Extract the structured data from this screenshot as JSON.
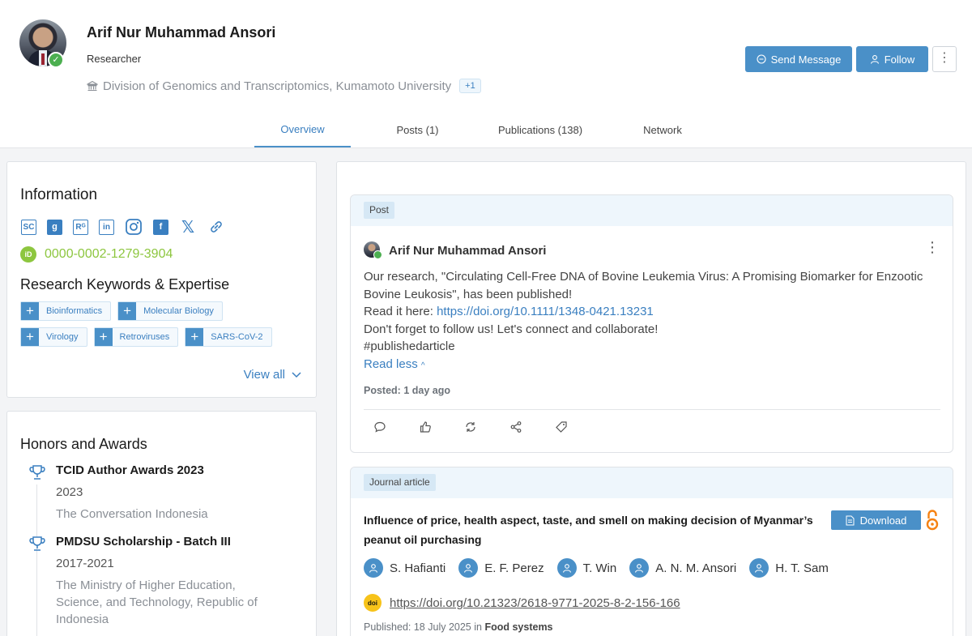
{
  "profile": {
    "name": "Arif Nur Muhammad Ansori",
    "role": "Researcher",
    "affiliation": "Division of Genomics and Transcriptomics, Kumamoto University",
    "affiliation_more": "+1",
    "verified_icon": "check-icon"
  },
  "actions": {
    "send_message": "Send Message",
    "follow": "Follow",
    "more": "⋮"
  },
  "tabs": [
    {
      "label": "Overview",
      "active": true
    },
    {
      "label": "Posts (1)",
      "active": false
    },
    {
      "label": "Publications (138)",
      "active": false
    },
    {
      "label": "Network",
      "active": false
    }
  ],
  "information": {
    "title": "Information",
    "socials": [
      {
        "name": "sciprofiles-icon",
        "glyph": "SC"
      },
      {
        "name": "google-scholar-icon",
        "glyph": "g"
      },
      {
        "name": "researchgate-icon",
        "glyph": "Rᴳ"
      },
      {
        "name": "linkedin-icon",
        "glyph": "in"
      },
      {
        "name": "instagram-icon",
        "glyph": ""
      },
      {
        "name": "facebook-icon",
        "glyph": "f"
      },
      {
        "name": "x-icon",
        "glyph": "𝕏"
      },
      {
        "name": "link-icon",
        "glyph": ""
      }
    ],
    "orcid": "0000-0002-1279-3904",
    "keywords_title": "Research Keywords & Expertise",
    "keywords": [
      "Bioinformatics",
      "Molecular Biology",
      "Virology",
      "Retroviruses",
      "SARS-CoV-2"
    ],
    "view_all": "View all"
  },
  "honors": {
    "title": "Honors and Awards",
    "items": [
      {
        "title": "TCID Author Awards 2023",
        "year": "2023",
        "org": "The Conversation Indonesia"
      },
      {
        "title": "PMDSU Scholarship - Batch III",
        "year": "2017-2021",
        "org": "The Ministry of Higher Education, Science, and Technology, Republic of Indonesia"
      }
    ]
  },
  "post": {
    "tag": "Post",
    "author": "Arif Nur Muhammad Ansori",
    "line1": "Our research, \"Circulating Cell-Free DNA of Bovine Leukemia Virus: A Promising Biomarker for Enzootic Bovine Leukosis\", has been published!",
    "read_prefix": "Read it here: ",
    "link": "https://doi.org/10.1111/1348-0421.13231",
    "line3": "Don't forget to follow us! Let's connect and collaborate!",
    "line4": "#publishedarticle",
    "read_less": "Read less",
    "posted_label": "Posted:",
    "posted_value": "1 day ago"
  },
  "article": {
    "tag": "Journal article",
    "title": "Influence of price, health aspect, taste, and smell on making decision of Myanmar’s peanut oil purchasing",
    "download": "Download",
    "authors": [
      "S. Hafianti",
      "E. F. Perez",
      "T. Win",
      "A. N. M. Ansori",
      "H. T. Sam"
    ],
    "doi_badge": "doi",
    "doi": "https://doi.org/10.21323/2618-9771-2025-8-2-156-166",
    "published_label": "Published:",
    "published_date": "18 July 2025",
    "published_in": "in",
    "journal": "Food systems"
  },
  "colors": {
    "accent": "#4a90c8",
    "orcid": "#8dc63f",
    "verified": "#4caf50",
    "open_access": "#f68212"
  }
}
